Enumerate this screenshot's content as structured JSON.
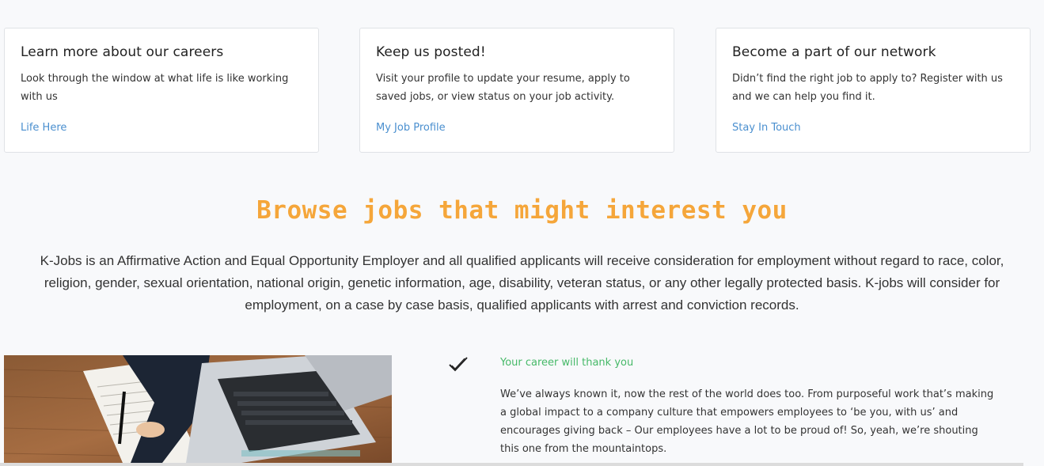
{
  "cards": [
    {
      "title": "Learn more about our careers",
      "text": "Look through the window at what life is like working with us",
      "link": "Life Here"
    },
    {
      "title": "Keep us posted!",
      "text": "Visit your profile to update your resume, apply to saved jobs, or view status on your job activity.",
      "link": "My Job Profile"
    },
    {
      "title": "Become a part of our network",
      "text": "Didn’t find the right job to apply to? Register with us and we can help you find it.",
      "link": "Stay In Touch"
    }
  ],
  "browse": {
    "heading": "Browse jobs that might interest you",
    "line1": "K-Jobs is an Affirmative Action and Equal Opportunity Employer and all qualified applicants will receive consideration for employment without regard to race, color,",
    "line2": "religion, gender, sexual orientation, national origin, genetic information, age, disability, veteran status, or any other legally protected basis. K-jobs will consider for",
    "line3": "employment, on a case by case basis, qualified applicants with arrest and conviction records."
  },
  "feature": {
    "icon": "checkmark-icon",
    "title": "Your career will thank you",
    "text": "We’ve always known it, now the rest of the world does too. From purposeful work that’s making a global impact to a company culture that empowers employees to ‘be you, with us’ and encourages giving back – Our employees have a lot to be proud of! So, yeah, we’re shouting this one from the mountaintops."
  },
  "colors": {
    "accent_orange": "#f5a63a",
    "link_blue": "#4a8fcf",
    "feature_green": "#46b968"
  }
}
